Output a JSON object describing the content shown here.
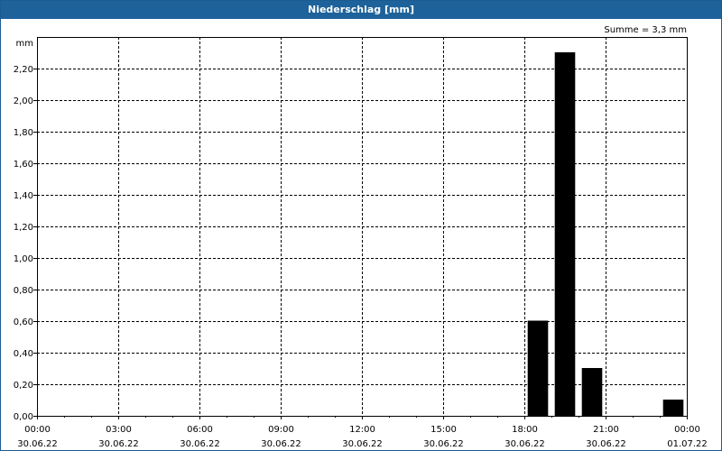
{
  "window": {
    "title": "Niederschlag [mm]"
  },
  "chart_data": {
    "type": "bar",
    "title": "Niederschlag [mm]",
    "ylabel": "mm",
    "annotation": "Summe = 3,3 mm",
    "ylim": [
      0,
      2.4
    ],
    "y_ticks": [
      "0,00",
      "0,20",
      "0,40",
      "0,60",
      "0,80",
      "1,00",
      "1,20",
      "1,40",
      "1,60",
      "1,80",
      "2,00",
      "2,20"
    ],
    "y_tick_values": [
      0,
      0.2,
      0.4,
      0.6,
      0.8,
      1.0,
      1.2,
      1.4,
      1.6,
      1.8,
      2.0,
      2.2
    ],
    "x_range_hours": [
      0,
      24
    ],
    "x_ticks": [
      {
        "time": "00:00",
        "date": "30.06.22",
        "hour": 0
      },
      {
        "time": "03:00",
        "date": "30.06.22",
        "hour": 3
      },
      {
        "time": "06:00",
        "date": "30.06.22",
        "hour": 6
      },
      {
        "time": "09:00",
        "date": "30.06.22",
        "hour": 9
      },
      {
        "time": "12:00",
        "date": "30.06.22",
        "hour": 12
      },
      {
        "time": "15:00",
        "date": "30.06.22",
        "hour": 15
      },
      {
        "time": "18:00",
        "date": "30.06.22",
        "hour": 18
      },
      {
        "time": "21:00",
        "date": "30.06.22",
        "hour": 21
      },
      {
        "time": "00:00",
        "date": "01.07.22",
        "hour": 24
      }
    ],
    "bars": [
      {
        "hour_start": 18,
        "value": 0.6
      },
      {
        "hour_start": 19,
        "value": 2.3
      },
      {
        "hour_start": 20,
        "value": 0.3
      },
      {
        "hour_start": 23,
        "value": 0.1
      }
    ],
    "grid": true,
    "bar_color": "#000000"
  }
}
